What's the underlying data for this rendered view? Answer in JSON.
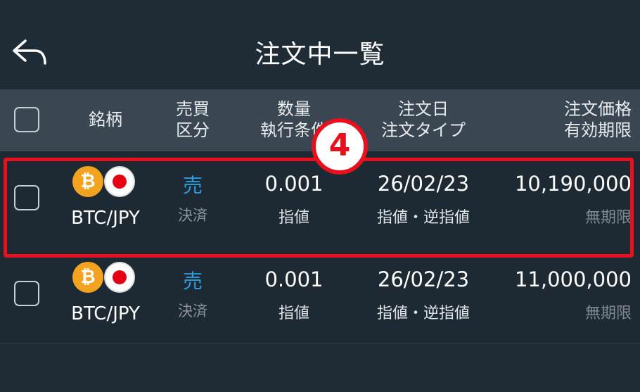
{
  "header": {
    "title": "注文中一覧",
    "back_icon": "back-arrow-icon"
  },
  "columns": {
    "symbol": "銘柄",
    "side_line1": "売買",
    "side_line2": "区分",
    "qty_line1": "数量",
    "qty_line2": "執行条件",
    "date_line1": "注文日",
    "date_line2": "注文タイプ",
    "price_line1": "注文価格",
    "price_line2": "有効期限"
  },
  "orders": [
    {
      "pair": "BTC/JPY",
      "base_icon": "bitcoin-icon",
      "quote_icon": "japan-flag-icon",
      "side": "売",
      "settlement": "決済",
      "quantity": "0.001",
      "condition": "指値",
      "date": "26/02/23",
      "order_type": "指値・逆指値",
      "price": "10,190,000",
      "expiry": "無期限"
    },
    {
      "pair": "BTC/JPY",
      "base_icon": "bitcoin-icon",
      "quote_icon": "japan-flag-icon",
      "side": "売",
      "settlement": "決済",
      "quantity": "0.001",
      "condition": "指値",
      "date": "26/02/23",
      "order_type": "指値・逆指値",
      "price": "11,000,000",
      "expiry": "無期限"
    }
  ],
  "annotation": {
    "step_number": "4"
  },
  "colors": {
    "accent_blue": "#2d9cdb",
    "highlight_red": "#e8101c",
    "btc_orange": "#f4a321"
  }
}
